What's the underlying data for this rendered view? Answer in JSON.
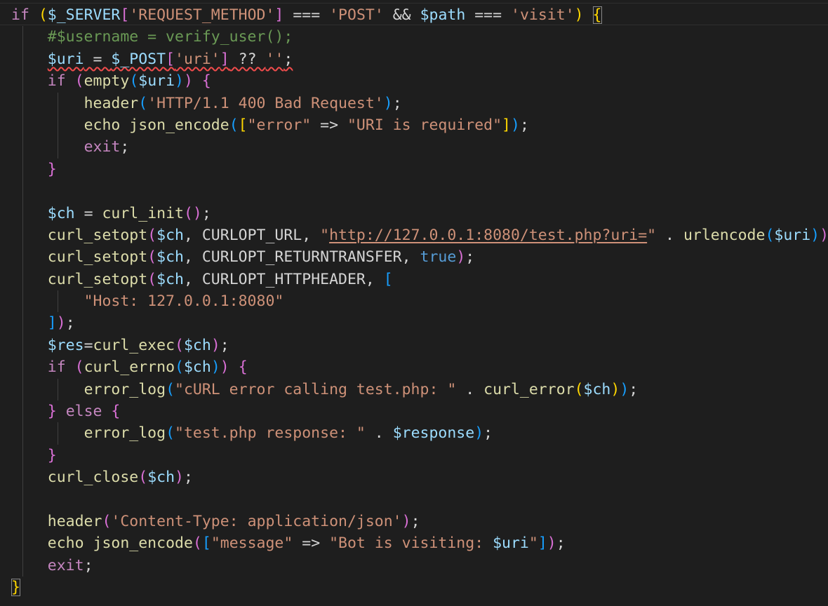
{
  "editor": {
    "lines": [
      [
        {
          "t": "if",
          "c": "kw"
        },
        {
          "t": " ",
          "c": "op"
        },
        {
          "t": "(",
          "c": "b1"
        },
        {
          "t": "$_SERVER",
          "c": "var"
        },
        {
          "t": "[",
          "c": "b2"
        },
        {
          "t": "'REQUEST_METHOD'",
          "c": "str"
        },
        {
          "t": "]",
          "c": "b2"
        },
        {
          "t": " === ",
          "c": "op"
        },
        {
          "t": "'POST'",
          "c": "str"
        },
        {
          "t": " && ",
          "c": "op"
        },
        {
          "t": "$path",
          "c": "var"
        },
        {
          "t": " === ",
          "c": "op"
        },
        {
          "t": "'visit'",
          "c": "str"
        },
        {
          "t": ")",
          "c": "b1"
        },
        {
          "t": " ",
          "c": "op"
        },
        {
          "t": "{",
          "c": "b1m"
        }
      ],
      [
        {
          "t": "    ",
          "c": "op"
        },
        {
          "t": "#$username = verify_user();",
          "c": "com"
        }
      ],
      [
        {
          "t": "    ",
          "c": "op"
        },
        {
          "t": "$uri = $_POST['uri'] ?? '';",
          "c": "sq",
          "parts": [
            {
              "t": "$uri",
              "c": "var"
            },
            {
              "t": " = ",
              "c": "op"
            },
            {
              "t": "$_POST",
              "c": "var"
            },
            {
              "t": "[",
              "c": "b2"
            },
            {
              "t": "'uri'",
              "c": "str"
            },
            {
              "t": "]",
              "c": "b2"
            },
            {
              "t": " ?? ",
              "c": "op"
            },
            {
              "t": "''",
              "c": "str"
            },
            {
              "t": ";",
              "c": "op"
            }
          ]
        }
      ],
      [
        {
          "t": "    ",
          "c": "op"
        },
        {
          "t": "if",
          "c": "kw"
        },
        {
          "t": " ",
          "c": "op"
        },
        {
          "t": "(",
          "c": "b2"
        },
        {
          "t": "empty",
          "c": "fn"
        },
        {
          "t": "(",
          "c": "b3"
        },
        {
          "t": "$uri",
          "c": "var"
        },
        {
          "t": ")",
          "c": "b3"
        },
        {
          "t": ")",
          "c": "b2"
        },
        {
          "t": " ",
          "c": "op"
        },
        {
          "t": "{",
          "c": "b2"
        }
      ],
      [
        {
          "t": "        ",
          "c": "op"
        },
        {
          "t": "header",
          "c": "fn"
        },
        {
          "t": "(",
          "c": "b3"
        },
        {
          "t": "'HTTP/1.1 400 Bad Request'",
          "c": "str"
        },
        {
          "t": ")",
          "c": "b3"
        },
        {
          "t": ";",
          "c": "op"
        }
      ],
      [
        {
          "t": "        ",
          "c": "op"
        },
        {
          "t": "echo",
          "c": "fn"
        },
        {
          "t": " ",
          "c": "op"
        },
        {
          "t": "json_encode",
          "c": "fn"
        },
        {
          "t": "(",
          "c": "b3"
        },
        {
          "t": "[",
          "c": "b1"
        },
        {
          "t": "\"error\"",
          "c": "str"
        },
        {
          "t": " => ",
          "c": "op"
        },
        {
          "t": "\"URI is required\"",
          "c": "str"
        },
        {
          "t": "]",
          "c": "b1"
        },
        {
          "t": ")",
          "c": "b3"
        },
        {
          "t": ";",
          "c": "op"
        }
      ],
      [
        {
          "t": "        ",
          "c": "op"
        },
        {
          "t": "exit",
          "c": "kw"
        },
        {
          "t": ";",
          "c": "op"
        }
      ],
      [
        {
          "t": "    ",
          "c": "op"
        },
        {
          "t": "}",
          "c": "b2"
        }
      ],
      [],
      [
        {
          "t": "    ",
          "c": "op"
        },
        {
          "t": "$ch",
          "c": "var"
        },
        {
          "t": " = ",
          "c": "op"
        },
        {
          "t": "curl_init",
          "c": "fn"
        },
        {
          "t": "(",
          "c": "b2"
        },
        {
          "t": ")",
          "c": "b2"
        },
        {
          "t": ";",
          "c": "op"
        }
      ],
      [
        {
          "t": "    ",
          "c": "op"
        },
        {
          "t": "curl_setopt",
          "c": "fn"
        },
        {
          "t": "(",
          "c": "b2"
        },
        {
          "t": "$ch",
          "c": "var"
        },
        {
          "t": ", ",
          "c": "op"
        },
        {
          "t": "CURLOPT_URL",
          "c": "op"
        },
        {
          "t": ", ",
          "c": "op"
        },
        {
          "t": "\"",
          "c": "str"
        },
        {
          "t": "http://127.0.0.1:8080/test.php?uri=",
          "c": "url"
        },
        {
          "t": "\"",
          "c": "str"
        },
        {
          "t": " . ",
          "c": "op"
        },
        {
          "t": "urlencode",
          "c": "fn"
        },
        {
          "t": "(",
          "c": "b3"
        },
        {
          "t": "$uri",
          "c": "var"
        },
        {
          "t": ")",
          "c": "b3"
        },
        {
          "t": ")",
          "c": "b2"
        },
        {
          "t": ";",
          "c": "op"
        }
      ],
      [
        {
          "t": "    ",
          "c": "op"
        },
        {
          "t": "curl_setopt",
          "c": "fn"
        },
        {
          "t": "(",
          "c": "b2"
        },
        {
          "t": "$ch",
          "c": "var"
        },
        {
          "t": ", ",
          "c": "op"
        },
        {
          "t": "CURLOPT_RETURNTRANSFER",
          "c": "op"
        },
        {
          "t": ", ",
          "c": "op"
        },
        {
          "t": "true",
          "c": "bool"
        },
        {
          "t": ")",
          "c": "b2"
        },
        {
          "t": ";",
          "c": "op"
        }
      ],
      [
        {
          "t": "    ",
          "c": "op"
        },
        {
          "t": "curl_setopt",
          "c": "fn"
        },
        {
          "t": "(",
          "c": "b2"
        },
        {
          "t": "$ch",
          "c": "var"
        },
        {
          "t": ", ",
          "c": "op"
        },
        {
          "t": "CURLOPT_HTTPHEADER",
          "c": "op"
        },
        {
          "t": ", ",
          "c": "op"
        },
        {
          "t": "[",
          "c": "b3"
        }
      ],
      [
        {
          "t": "        ",
          "c": "op"
        },
        {
          "t": "\"Host: 127.0.0.1:8080\"",
          "c": "str"
        }
      ],
      [
        {
          "t": "    ",
          "c": "op"
        },
        {
          "t": "]",
          "c": "b3"
        },
        {
          "t": ")",
          "c": "b2"
        },
        {
          "t": ";",
          "c": "op"
        }
      ],
      [
        {
          "t": "    ",
          "c": "op"
        },
        {
          "t": "$res",
          "c": "var"
        },
        {
          "t": "=",
          "c": "op"
        },
        {
          "t": "curl_exec",
          "c": "fn"
        },
        {
          "t": "(",
          "c": "b2"
        },
        {
          "t": "$ch",
          "c": "var"
        },
        {
          "t": ")",
          "c": "b2"
        },
        {
          "t": ";",
          "c": "op"
        }
      ],
      [
        {
          "t": "    ",
          "c": "op"
        },
        {
          "t": "if",
          "c": "kw"
        },
        {
          "t": " ",
          "c": "op"
        },
        {
          "t": "(",
          "c": "b2"
        },
        {
          "t": "curl_errno",
          "c": "fn"
        },
        {
          "t": "(",
          "c": "b3"
        },
        {
          "t": "$ch",
          "c": "var"
        },
        {
          "t": ")",
          "c": "b3"
        },
        {
          "t": ")",
          "c": "b2"
        },
        {
          "t": " ",
          "c": "op"
        },
        {
          "t": "{",
          "c": "b2"
        }
      ],
      [
        {
          "t": "        ",
          "c": "op"
        },
        {
          "t": "error_log",
          "c": "fn"
        },
        {
          "t": "(",
          "c": "b3"
        },
        {
          "t": "\"cURL error calling test.php: \"",
          "c": "str"
        },
        {
          "t": " . ",
          "c": "op"
        },
        {
          "t": "curl_error",
          "c": "fn"
        },
        {
          "t": "(",
          "c": "b1"
        },
        {
          "t": "$ch",
          "c": "var"
        },
        {
          "t": ")",
          "c": "b1"
        },
        {
          "t": ")",
          "c": "b3"
        },
        {
          "t": ";",
          "c": "op"
        }
      ],
      [
        {
          "t": "    ",
          "c": "op"
        },
        {
          "t": "}",
          "c": "b2"
        },
        {
          "t": " ",
          "c": "op"
        },
        {
          "t": "else",
          "c": "kw"
        },
        {
          "t": " ",
          "c": "op"
        },
        {
          "t": "{",
          "c": "b2"
        }
      ],
      [
        {
          "t": "        ",
          "c": "op"
        },
        {
          "t": "error_log",
          "c": "fn"
        },
        {
          "t": "(",
          "c": "b3"
        },
        {
          "t": "\"test.php response: \"",
          "c": "str"
        },
        {
          "t": " . ",
          "c": "op"
        },
        {
          "t": "$response",
          "c": "var"
        },
        {
          "t": ")",
          "c": "b3"
        },
        {
          "t": ";",
          "c": "op"
        }
      ],
      [
        {
          "t": "    ",
          "c": "op"
        },
        {
          "t": "}",
          "c": "b2"
        }
      ],
      [
        {
          "t": "    ",
          "c": "op"
        },
        {
          "t": "curl_close",
          "c": "fn"
        },
        {
          "t": "(",
          "c": "b2"
        },
        {
          "t": "$ch",
          "c": "var"
        },
        {
          "t": ")",
          "c": "b2"
        },
        {
          "t": ";",
          "c": "op"
        }
      ],
      [],
      [
        {
          "t": "    ",
          "c": "op"
        },
        {
          "t": "header",
          "c": "fn"
        },
        {
          "t": "(",
          "c": "b2"
        },
        {
          "t": "'Content-Type: application/json'",
          "c": "str"
        },
        {
          "t": ")",
          "c": "b2"
        },
        {
          "t": ";",
          "c": "op"
        }
      ],
      [
        {
          "t": "    ",
          "c": "op"
        },
        {
          "t": "echo",
          "c": "fn"
        },
        {
          "t": " ",
          "c": "op"
        },
        {
          "t": "json_encode",
          "c": "fn"
        },
        {
          "t": "(",
          "c": "b2"
        },
        {
          "t": "[",
          "c": "b3"
        },
        {
          "t": "\"message\"",
          "c": "str"
        },
        {
          "t": " => ",
          "c": "op"
        },
        {
          "t": "\"Bot is visiting: ",
          "c": "str"
        },
        {
          "t": "$uri",
          "c": "var"
        },
        {
          "t": "\"",
          "c": "str"
        },
        {
          "t": "]",
          "c": "b3"
        },
        {
          "t": ")",
          "c": "b2"
        },
        {
          "t": ";",
          "c": "op"
        }
      ],
      [
        {
          "t": "    ",
          "c": "op"
        },
        {
          "t": "exit",
          "c": "kw"
        },
        {
          "t": ";",
          "c": "op"
        }
      ],
      [
        {
          "t": "}",
          "c": "b1m"
        }
      ]
    ],
    "guides": {
      "1": [
        1
      ],
      "2": [
        1
      ],
      "3": [
        1
      ],
      "4": [
        1,
        2
      ],
      "5": [
        1,
        2
      ],
      "6": [
        1,
        2
      ],
      "7": [
        1
      ],
      "8": [
        1
      ],
      "9": [
        1
      ],
      "10": [
        1
      ],
      "11": [
        1
      ],
      "12": [
        1
      ],
      "13": [
        1,
        2
      ],
      "14": [
        1
      ],
      "15": [
        1
      ],
      "16": [
        1
      ],
      "17": [
        1,
        2
      ],
      "18": [
        1
      ],
      "19": [
        1,
        2
      ],
      "20": [
        1
      ],
      "21": [
        1
      ],
      "22": [
        1
      ],
      "23": [
        1
      ],
      "24": [
        1
      ],
      "25": [
        1
      ]
    }
  }
}
